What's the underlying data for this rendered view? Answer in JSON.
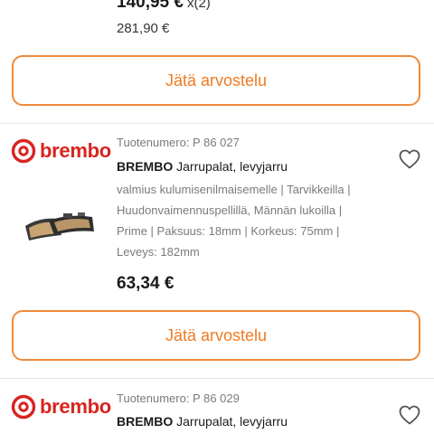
{
  "previous_item": {
    "unit_price": "140,95 €",
    "quantity": "x(2)",
    "total": "281,90 €"
  },
  "review_button_label": "Jätä arvostelu",
  "products": [
    {
      "brand_logo_text": "brembo",
      "article_number": "Tuotenumero: P 86 027",
      "brand": "BREMBO",
      "name": "Jarrupalat, levyjarru",
      "desc_lines": [
        "valmius kulumisenilmaisemelle | Tarvikkeilla |",
        "Huudonvaimennuspellillä, Männän lukoilla |",
        "Prime | Paksuus: 18mm | Korkeus: 75mm |",
        "Leveys: 182mm"
      ],
      "price": "63,34 €"
    },
    {
      "brand_logo_text": "brembo",
      "article_number": "Tuotenumero: P 86 029",
      "brand": "BREMBO",
      "name": "Jarrupalat, levyjarru"
    }
  ],
  "colors": {
    "accent": "#ef7a1f",
    "brand_red": "#d8241f"
  },
  "icons": [
    "brembo-logo-icon",
    "heart-icon",
    "brake-pads-image"
  ]
}
